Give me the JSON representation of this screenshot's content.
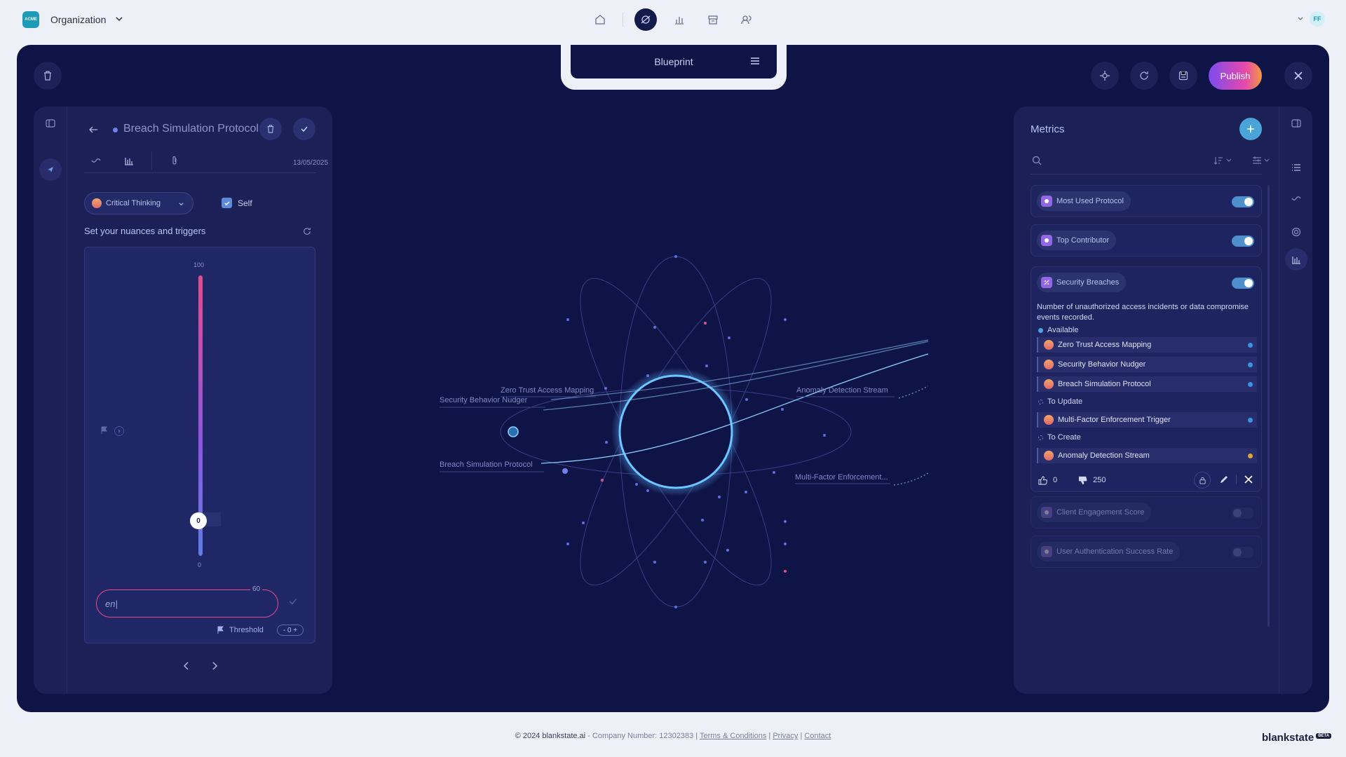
{
  "header": {
    "logo_text": "ACME",
    "org_label": "Organization",
    "avatar_initials": "FF",
    "nav_icons": [
      "home-icon",
      "orbit-icon",
      "chart-icon",
      "archive-icon",
      "team-icon"
    ]
  },
  "blueprint": {
    "title": "Blueprint"
  },
  "toolbar": {
    "publish_label": "Publish"
  },
  "left_panel": {
    "title": "Breach Simulation Protocol",
    "date": "13/05/2025",
    "skill_label": "Critical Thinking",
    "self_label": "Self",
    "self_checked": true,
    "section_title": "Set your nuances and triggers",
    "slider": {
      "max_label": "100",
      "min_label": "0",
      "value": "0"
    },
    "input": {
      "value": "en|",
      "char_count": "60"
    },
    "threshold_label": "Threshold",
    "threshold_value": "- 0 +"
  },
  "graph": {
    "nodes": [
      {
        "label": "Zero Trust Access Mapping"
      },
      {
        "label": "Security Behavior Nudger"
      },
      {
        "label": "Breach Simulation Protocol"
      },
      {
        "label": "Anomaly Detection Stream"
      },
      {
        "label": "Multi-Factor Enforcement..."
      }
    ]
  },
  "metrics": {
    "title": "Metrics",
    "items": [
      {
        "label": "Most Used Protocol",
        "enabled": true
      },
      {
        "label": "Top Contributor",
        "enabled": true
      },
      {
        "label": "Security Breaches",
        "enabled": true
      },
      {
        "label": "Client Engagement Score",
        "enabled": false
      },
      {
        "label": "User Authentication Success Rate",
        "enabled": false
      }
    ],
    "expanded": {
      "description": "Number of unauthorized access incidents or data compromise events recorded.",
      "groups": {
        "available": {
          "label": "Available",
          "items": [
            "Zero Trust Access Mapping",
            "Security Behavior Nudger",
            "Breach Simulation Protocol"
          ]
        },
        "to_update": {
          "label": "To Update",
          "items": [
            "Multi-Factor Enforcement Trigger"
          ]
        },
        "to_create": {
          "label": "To Create",
          "items": [
            "Anomaly Detection Stream"
          ]
        }
      },
      "likes": "0",
      "dislikes": "250"
    }
  },
  "footer": {
    "copyright": "© 2024 blankstate.ai",
    "company": " - Company Number: 12302383 | ",
    "terms": "Terms & Conditions",
    "privacy": "Privacy",
    "contact": "Contact",
    "brand": "blankstate",
    "beta": "BETA"
  }
}
